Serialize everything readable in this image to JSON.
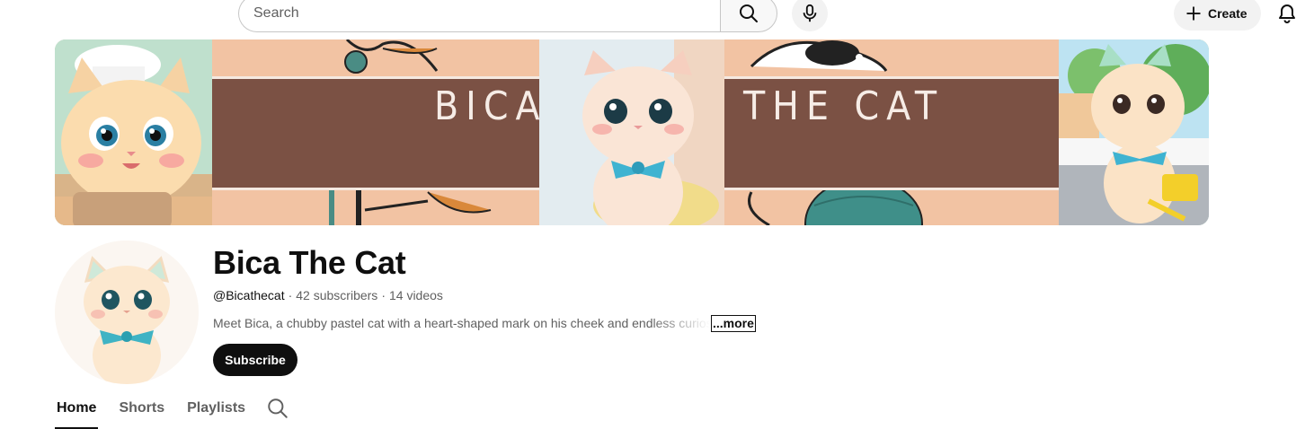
{
  "search": {
    "placeholder": "Search"
  },
  "topbar": {
    "create_label": "Create"
  },
  "banner": {
    "word_left": "BICA",
    "word_right": "THE CAT"
  },
  "channel": {
    "name": "Bica The Cat",
    "handle": "@Bicathecat",
    "subscribers": "42 subscribers",
    "videos": "14 videos",
    "separator": "·",
    "description": "Meet Bica, a chubby pastel cat with a heart-shaped mark on his cheek and endless curios",
    "more_label": "...more",
    "subscribe_label": "Subscribe"
  },
  "tabs": [
    {
      "label": "Home",
      "active": true
    },
    {
      "label": "Shorts",
      "active": false
    },
    {
      "label": "Playlists",
      "active": false
    }
  ],
  "icons": [
    "search-icon",
    "microphone-icon",
    "plus-icon",
    "bell-icon",
    "tab-search-icon"
  ],
  "colors": {
    "banner_brown": "#7b5144",
    "banner_peach": "#f2c3a3",
    "subscribe_bg": "#0f0f0f"
  }
}
